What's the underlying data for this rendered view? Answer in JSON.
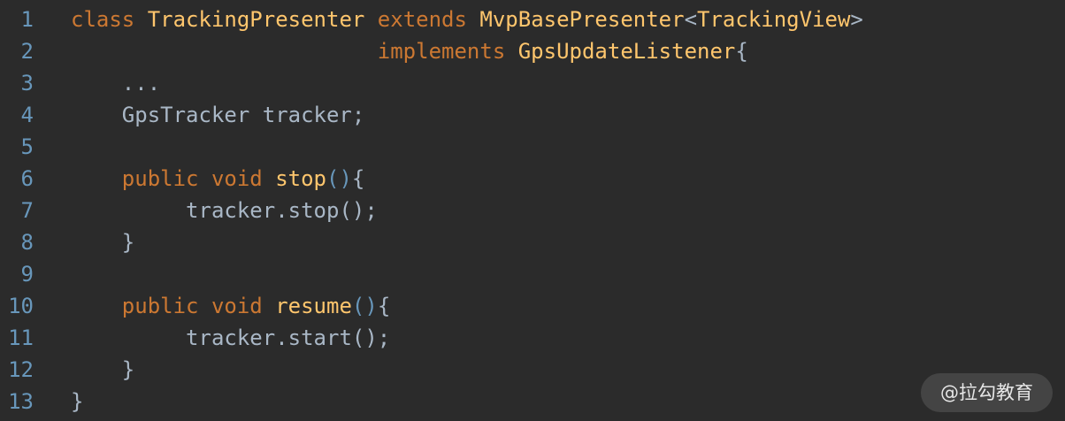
{
  "lines": [
    {
      "n": "1",
      "indent": "",
      "tokens": [
        {
          "t": "class ",
          "c": "kw"
        },
        {
          "t": "TrackingPresenter ",
          "c": "cls"
        },
        {
          "t": "extends ",
          "c": "kw"
        },
        {
          "t": "MvpBasePresenter",
          "c": "cls"
        },
        {
          "t": "<",
          "c": "plain"
        },
        {
          "t": "TrackingView",
          "c": "cls"
        },
        {
          "t": ">",
          "c": "plain"
        }
      ]
    },
    {
      "n": "2",
      "indent": "                        ",
      "tokens": [
        {
          "t": "implements ",
          "c": "kw"
        },
        {
          "t": "GpsUpdateListener",
          "c": "cls"
        },
        {
          "t": "{",
          "c": "plain"
        }
      ]
    },
    {
      "n": "3",
      "indent": "    ",
      "tokens": [
        {
          "t": "...",
          "c": "plain"
        }
      ]
    },
    {
      "n": "4",
      "indent": "    ",
      "tokens": [
        {
          "t": "GpsTracker tracker;",
          "c": "plain"
        }
      ]
    },
    {
      "n": "5",
      "indent": "",
      "tokens": []
    },
    {
      "n": "6",
      "indent": "    ",
      "tokens": [
        {
          "t": "public ",
          "c": "kw"
        },
        {
          "t": "void ",
          "c": "kw"
        },
        {
          "t": "stop",
          "c": "fn"
        },
        {
          "t": "()",
          "c": "paren"
        },
        {
          "t": "{",
          "c": "plain"
        }
      ]
    },
    {
      "n": "7",
      "indent": "         ",
      "tokens": [
        {
          "t": "tracker.stop();",
          "c": "plain"
        }
      ]
    },
    {
      "n": "8",
      "indent": "    ",
      "tokens": [
        {
          "t": "}",
          "c": "plain"
        }
      ]
    },
    {
      "n": "9",
      "indent": "",
      "tokens": []
    },
    {
      "n": "10",
      "indent": "    ",
      "tokens": [
        {
          "t": "public ",
          "c": "kw"
        },
        {
          "t": "void ",
          "c": "kw"
        },
        {
          "t": "resume",
          "c": "fn"
        },
        {
          "t": "()",
          "c": "paren"
        },
        {
          "t": "{",
          "c": "plain"
        }
      ]
    },
    {
      "n": "11",
      "indent": "         ",
      "tokens": [
        {
          "t": "tracker.start();",
          "c": "plain"
        }
      ]
    },
    {
      "n": "12",
      "indent": "    ",
      "tokens": [
        {
          "t": "}",
          "c": "plain"
        }
      ]
    },
    {
      "n": "13",
      "indent": "",
      "tokens": [
        {
          "t": "}",
          "c": "plain"
        }
      ]
    }
  ],
  "watermark": "@拉勾教育",
  "colors": {
    "background": "#2b2b2b",
    "keyword": "#cc7832",
    "class_name": "#ffc66d",
    "plain": "#a9b7c6",
    "line_number": "#6897bb"
  }
}
